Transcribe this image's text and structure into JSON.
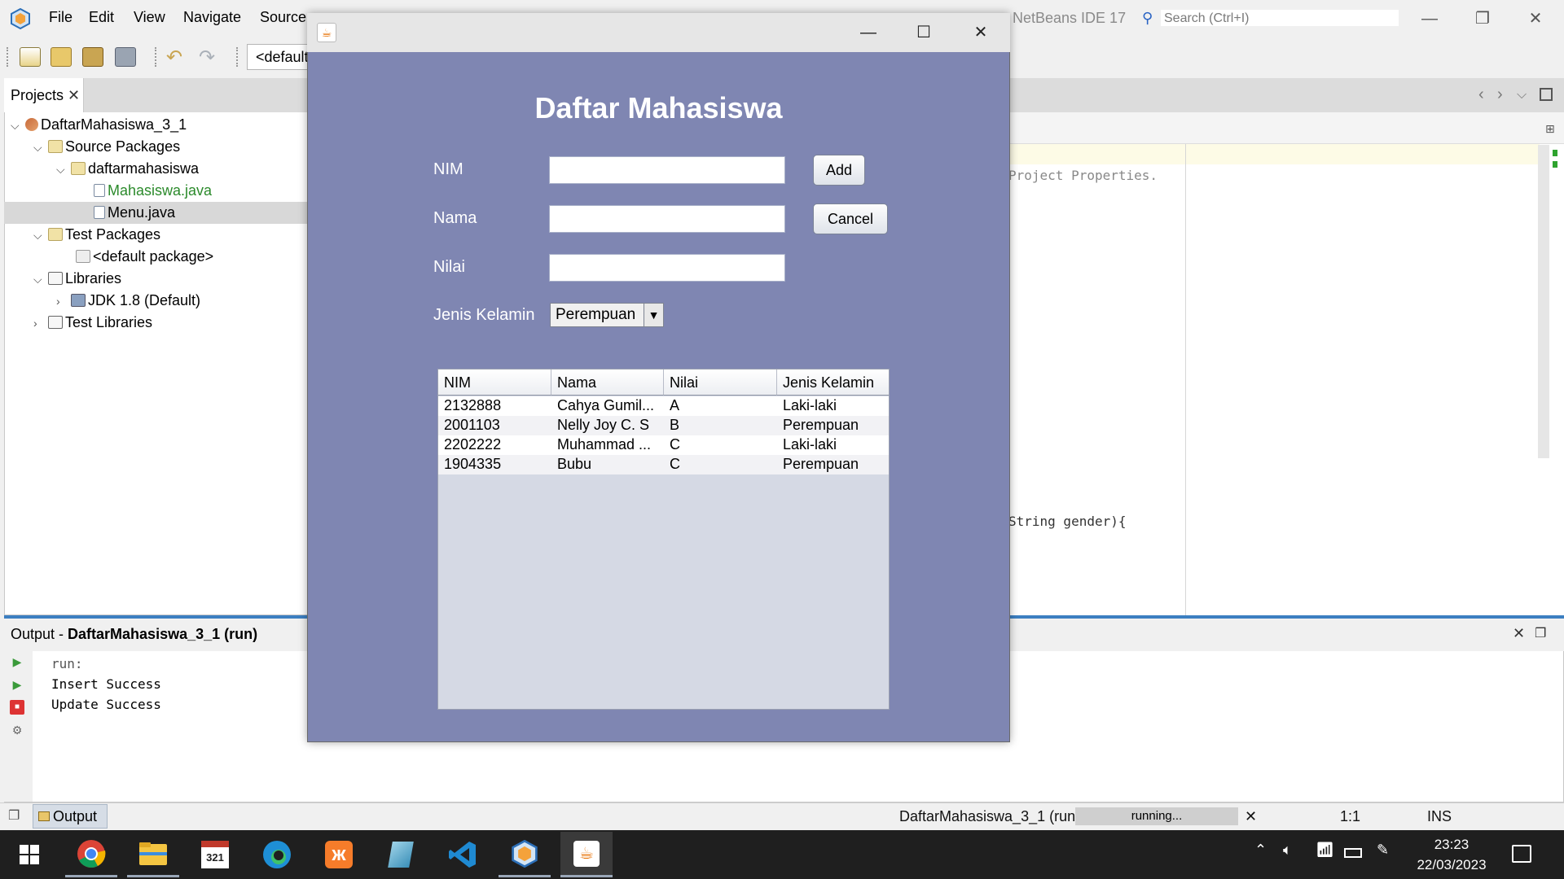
{
  "ide": {
    "title": "NetBeans IDE 17",
    "menus": [
      "File",
      "Edit",
      "View",
      "Navigate",
      "Source"
    ],
    "search_placeholder": "Search (Ctrl+I)",
    "config_combo": "<default config>",
    "projects_tab": "Projects",
    "tree": [
      {
        "label": "DaftarMahasiswa_3_1",
        "icon": "project-icon",
        "twisty": "expanded"
      },
      {
        "label": "Source Packages",
        "icon": "package-folder-icon",
        "twisty": "expanded"
      },
      {
        "label": "daftarmahasiswa",
        "icon": "package-icon",
        "twisty": "expanded"
      },
      {
        "label": "Mahasiswa.java",
        "icon": "java-file-icon",
        "twisty": ""
      },
      {
        "label": "Menu.java",
        "icon": "java-form-icon",
        "twisty": ""
      },
      {
        "label": "Test Packages",
        "icon": "package-folder-icon",
        "twisty": "expanded"
      },
      {
        "label": "<default package>",
        "icon": "package-icon",
        "twisty": ""
      },
      {
        "label": "Libraries",
        "icon": "library-icon",
        "twisty": "expanded"
      },
      {
        "label": "JDK 1.8 (Default)",
        "icon": "jdk-icon",
        "twisty": "collapsed"
      },
      {
        "label": "Test Libraries",
        "icon": "library-icon",
        "twisty": "collapsed"
      }
    ],
    "code_snippets": [
      "Project Properties.",
      "String gender){"
    ],
    "output": {
      "title_prefix": "Output - ",
      "title_project": "DaftarMahasiswa_3_1 (run)",
      "lines": [
        "run:",
        "Insert Success",
        "Update Success"
      ]
    },
    "status": {
      "output_tab": "Output",
      "run_label": "DaftarMahasiswa_3_1 (run)",
      "progress_label": "running...",
      "position": "1:1",
      "mode": "INS"
    }
  },
  "dialog": {
    "title": "Daftar Mahasiswa",
    "labels": {
      "nim": "NIM",
      "nama": "Nama",
      "nilai": "Nilai",
      "jenis_kelamin": "Jenis Kelamin"
    },
    "inputs": {
      "nim": "",
      "nama": "",
      "nilai": ""
    },
    "buttons": {
      "add": "Add",
      "cancel": "Cancel"
    },
    "gender_selected": "Perempuan",
    "table": {
      "columns": [
        "NIM",
        "Nama",
        "Nilai",
        "Jenis Kelamin"
      ],
      "rows": [
        [
          "2132888",
          "Cahya Gumil...",
          "A",
          "Laki-laki"
        ],
        [
          "2001103",
          "Nelly Joy C. S",
          "B",
          "Perempuan"
        ],
        [
          "2202222",
          "Muhammad ...",
          "C",
          "Laki-laki"
        ],
        [
          "1904335",
          "Bubu",
          "C",
          "Perempuan"
        ]
      ]
    }
  },
  "taskbar": {
    "apps": [
      "start-icon",
      "chrome-icon",
      "file-explorer-icon",
      "calendar-app-icon",
      "edge-icon",
      "xampp-icon",
      "notepad-icon",
      "vscode-icon",
      "netbeans-icon",
      "java-app-icon"
    ],
    "time": "23:23",
    "date": "22/03/2023"
  },
  "colors": {
    "dialog_bg": "#7f86b2",
    "table_bg": "#d5d9e4",
    "splitter": "#3c7fc1",
    "taskbar": "#1f1f1f"
  }
}
